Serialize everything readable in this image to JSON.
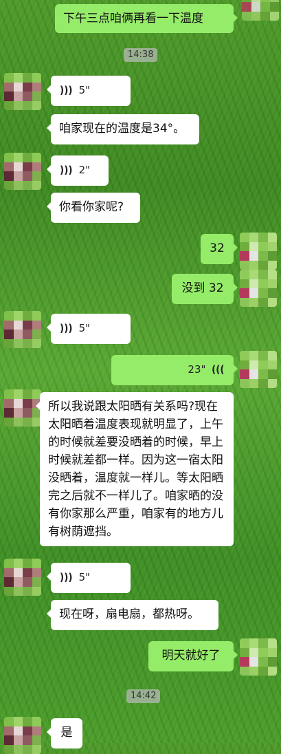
{
  "colors": {
    "incoming_bubble": "#ffffff",
    "outgoing_bubble": "#95ec69",
    "timestamp_bg": "#b4b9b4"
  },
  "icons": {
    "voice_incoming": "voice-wave-icon",
    "voice_outgoing": "voice-wave-icon"
  },
  "messages": [
    {
      "side": "right",
      "type": "text",
      "text": "下午三点咱俩再看一下温度"
    },
    {
      "type": "timestamp",
      "text": "14:38"
    },
    {
      "side": "left",
      "type": "voice",
      "duration": "5\""
    },
    {
      "side": "left",
      "type": "text",
      "text": "咱家现在的温度是34°。"
    },
    {
      "side": "left",
      "type": "voice",
      "duration": "2\""
    },
    {
      "side": "left",
      "type": "text",
      "text": "你看你家呢?"
    },
    {
      "side": "right",
      "type": "text",
      "text": "32"
    },
    {
      "side": "right",
      "type": "text",
      "text": "没到 32"
    },
    {
      "side": "left",
      "type": "voice",
      "duration": "5\""
    },
    {
      "side": "right",
      "type": "voice",
      "duration": "23\""
    },
    {
      "side": "left",
      "type": "text",
      "text": "所以我说跟太阳晒有关系吗?现在太阳晒着温度表现就明显了，上午的时候就差要没晒着的时候，早上时候就差都一样。因为这一宿太阳没晒着，温度就一样儿。等太阳晒完之后就不一样儿了。咱家晒的没有你家那么严重，咱家有的地方儿有树荫遮挡。"
    },
    {
      "side": "left",
      "type": "voice",
      "duration": "5\""
    },
    {
      "side": "left",
      "type": "text",
      "text": "现在呀，扇电扇，都热呀。"
    },
    {
      "side": "right",
      "type": "text",
      "text": "明天就好了"
    },
    {
      "type": "timestamp",
      "text": "14:42"
    },
    {
      "side": "left",
      "type": "text",
      "text": "是"
    }
  ]
}
